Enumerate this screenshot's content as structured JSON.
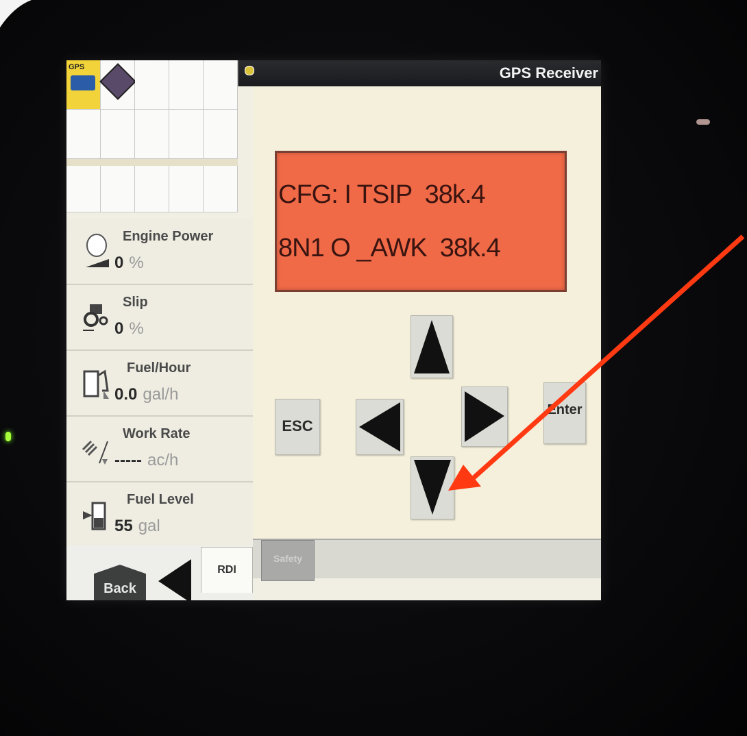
{
  "screen": {
    "title": "GPS Receiver",
    "lcd": {
      "line1": "CFG: I TSIP  38k.4",
      "line2": "8N1 O _AWK  38k.4",
      "background": "#f06a47"
    },
    "keys": {
      "esc_label": "ESC",
      "enter_label": "Enter"
    }
  },
  "sidebar": {
    "gps_tile_label": "GPS",
    "gauges": [
      {
        "title": "Engine Power",
        "value": "0",
        "unit": "%",
        "icon": "engine-icon"
      },
      {
        "title": "Slip",
        "value": "0",
        "unit": "%",
        "icon": "tractor-slip-icon"
      },
      {
        "title": "Fuel/Hour",
        "value": "0.0",
        "unit": "gal/h",
        "icon": "fuel-rate-icon"
      },
      {
        "title": "Work Rate",
        "value": "-----",
        "unit": "ac/h",
        "icon": "work-rate-icon"
      },
      {
        "title": "Fuel Level",
        "value": "55",
        "unit": "gal",
        "icon": "fuel-level-icon"
      }
    ]
  },
  "footer": {
    "back_label": "Back",
    "rdi_tab": "RDI",
    "safety_tab": "Safety"
  },
  "colors": {
    "annotation_arrow": "#ff3a12",
    "gps_tile": "#f2d33a"
  }
}
